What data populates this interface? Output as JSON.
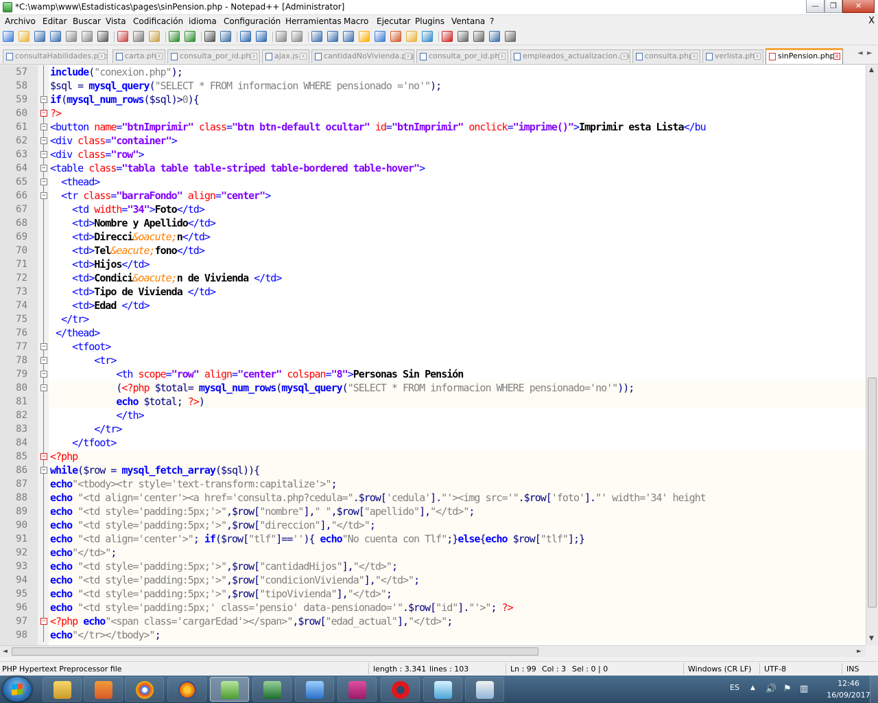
{
  "window": {
    "title": "*C:\\wamp\\www\\Estadisticas\\pages\\sinPension.php - Notepad++ [Administrator]",
    "min_label": "—",
    "max_label": "❐",
    "close_label": "✕"
  },
  "menu": [
    "Archivo",
    "Editar",
    "Buscar",
    "Vista",
    "Codificación",
    "idioma",
    "Configuración",
    "Herramientas",
    "Macro",
    "Ejecutar",
    "Plugins",
    "Ventana",
    "?"
  ],
  "menu_close": "X",
  "toolbar_icons": [
    "new-file-icon",
    "open-file-icon",
    "save-icon",
    "save-all-icon",
    "close-icon",
    "close-all-icon",
    "print-icon",
    "cut-icon",
    "copy-icon",
    "paste-icon",
    "undo-icon",
    "redo-icon",
    "find-icon",
    "replace-icon",
    "zoom-in-icon",
    "zoom-out-icon",
    "sync-v-icon",
    "sync-h-icon",
    "wrap-icon",
    "all-chars-icon",
    "indent-guide-icon",
    "user-lang-icon",
    "doc-map-icon",
    "function-list-icon",
    "folder-workspace-icon",
    "monitor-icon",
    "record-macro-icon",
    "stop-macro-icon",
    "play-macro-icon",
    "run-macro-multiple-icon",
    "save-macro-icon"
  ],
  "tabs": [
    {
      "label": "consultaHabilidades.php",
      "active": false
    },
    {
      "label": "carta.php",
      "active": false
    },
    {
      "label": "consulta_por_id.php",
      "active": false
    },
    {
      "label": "ajax.js",
      "active": false
    },
    {
      "label": "cantidadNoVivienda.php",
      "active": false
    },
    {
      "label": "consulta_por_id.php",
      "active": false
    },
    {
      "label": "empleados_actualizacion.php",
      "active": false
    },
    {
      "label": "consulta.php",
      "active": false
    },
    {
      "label": "verlista.php",
      "active": false
    },
    {
      "label": "sinPension.php",
      "active": true
    }
  ],
  "tab_close": "x",
  "tab_nav": [
    "◄",
    "►"
  ],
  "code_lines": [
    {
      "n": "57",
      "html": "<span class='k'>include</span><span class='o'>(</span><span class='s'>\"conexion.php\"</span><span class='o'>);</span>"
    },
    {
      "n": "58",
      "html": "<span class='v'>$sql</span> <span class='o'>=</span> <span class='k'>mysql_query</span><span class='o'>(</span><span class='s'>\"SELECT * FROM informacion WHERE pensionado ='no'\"</span><span class='o'>);</span>"
    },
    {
      "n": "59",
      "html": "<span class='k'>if</span><span class='o'>(</span><span class='k'>mysql_num_rows</span><span class='o'>(</span><span class='v'>$sql</span><span class='o'>)&gt;</span><span class='s'>0</span><span class='o'>){</span>"
    },
    {
      "n": "60",
      "html": "<span class='pt'>?&gt;</span>"
    },
    {
      "n": "61",
      "html": "<span class='t'>&lt;button</span> <span class='a'>name</span><span class='t'>=</span><span class='hv'>\"btnImprimir\"</span> <span class='a'>class</span><span class='t'>=</span><span class='hv'>\"btn btn-default ocultar\"</span> <span class='a'>id</span><span class='t'>=</span><span class='hv'>\"btnImprimir\"</span> <span class='a'>onclick</span><span class='t'>=</span><span class='hv'>\"imprime()\"</span><span class='t'>&gt;</span><span class='b'>Imprimir esta Lista</span><span class='t'>&lt;/bu</span>"
    },
    {
      "n": "62",
      "html": "<span class='t'>&lt;div</span> <span class='a'>class</span><span class='t'>=</span><span class='hv'>\"container\"</span><span class='t'>&gt;</span>"
    },
    {
      "n": "63",
      "html": "<span class='t'>&lt;div</span> <span class='a'>class</span><span class='t'>=</span><span class='hv'>\"row\"</span><span class='t'>&gt;</span>"
    },
    {
      "n": "64",
      "html": "<span class='t'>&lt;table</span> <span class='a'>class</span><span class='t'>=</span><span class='hv'>\"tabla table table-striped table-bordered table-hover\"</span><span class='t'>&gt;</span>"
    },
    {
      "n": "65",
      "html": "  <span class='t'>&lt;thead&gt;</span>"
    },
    {
      "n": "66",
      "html": "  <span class='t'>&lt;tr</span> <span class='a'>class</span><span class='t'>=</span><span class='hv'>\"barraFondo\"</span> <span class='a'>align</span><span class='t'>=</span><span class='hv'>\"center\"</span><span class='t'>&gt;</span>"
    },
    {
      "n": "67",
      "html": "    <span class='t'>&lt;td</span> <span class='a'>width</span><span class='t'>=</span><span class='hv'>\"34\"</span><span class='t'>&gt;</span><span class='b'>Foto</span><span class='t'>&lt;/td&gt;</span>"
    },
    {
      "n": "68",
      "html": "    <span class='t'>&lt;td&gt;</span><span class='b'>Nombre y Apellido</span><span class='t'>&lt;/td&gt;</span>"
    },
    {
      "n": "69",
      "html": "    <span class='t'>&lt;td&gt;</span><span class='b'>Direcci</span><span class='ent'>&amp;oacute;</span><span class='b'>n</span><span class='t'>&lt;/td&gt;</span>"
    },
    {
      "n": "70",
      "html": "    <span class='t'>&lt;td&gt;</span><span class='b'>Tel</span><span class='ent'>&amp;eacute;</span><span class='b'>fono</span><span class='t'>&lt;/td&gt;</span>"
    },
    {
      "n": "71",
      "html": "    <span class='t'>&lt;td&gt;</span><span class='b'>Hijos</span><span class='t'>&lt;/td&gt;</span>"
    },
    {
      "n": "72",
      "html": "    <span class='t'>&lt;td&gt;</span><span class='b'>Condici</span><span class='ent'>&amp;oacute;</span><span class='b'>n de Vivienda </span><span class='t'>&lt;/td&gt;</span>"
    },
    {
      "n": "73",
      "html": "    <span class='t'>&lt;td&gt;</span><span class='b'>Tipo de Vivienda </span><span class='t'>&lt;/td&gt;</span>"
    },
    {
      "n": "74",
      "html": "    <span class='t'>&lt;td&gt;</span><span class='b'>Edad </span><span class='t'>&lt;/td&gt;</span>"
    },
    {
      "n": "75",
      "html": "  <span class='t'>&lt;/tr&gt;</span>"
    },
    {
      "n": "76",
      "html": " <span class='t'>&lt;/thead&gt;</span>"
    },
    {
      "n": "77",
      "html": "    <span class='t'>&lt;tfoot&gt;</span>"
    },
    {
      "n": "78",
      "html": "        <span class='t'>&lt;tr&gt;</span>"
    },
    {
      "n": "79",
      "html": "            <span class='t'>&lt;th</span> <span class='a'>scope</span><span class='t'>=</span><span class='hv'>\"row\"</span> <span class='a'>align</span><span class='t'>=</span><span class='hv'>\"center\"</span> <span class='a'>colspan</span><span class='t'>=</span><span class='hv'>\"8\"</span><span class='t'>&gt;</span><span class='b'>Personas Sin Pensión</span>"
    },
    {
      "n": "80",
      "html": "            <span class='o'>(</span><span class='pt'>&lt;?php</span> <span class='v'>$total</span><span class='o'>=</span> <span class='k'>mysql_num_rows</span><span class='o'>(</span><span class='k'>mysql_query</span><span class='o'>(</span><span class='s'>\"SELECT * FROM informacion WHERE pensionado='no'\"</span><span class='o'>));</span>"
    },
    {
      "n": "81",
      "html": "            <span class='k'>echo</span> <span class='v'>$total</span><span class='o'>;</span> <span class='pt'>?&gt;</span><span class='o'>)</span>"
    },
    {
      "n": "82",
      "html": "            <span class='t'>&lt;/th&gt;</span>"
    },
    {
      "n": "83",
      "html": "        <span class='t'>&lt;/tr&gt;</span>"
    },
    {
      "n": "84",
      "html": "    <span class='t'>&lt;/tfoot&gt;</span>"
    },
    {
      "n": "85",
      "html": "<span class='pt'>&lt;?php</span>"
    },
    {
      "n": "86",
      "html": "<span class='k'>while</span><span class='o'>(</span><span class='v'>$row</span> <span class='o'>=</span> <span class='k'>mysql_fetch_array</span><span class='o'>(</span><span class='v'>$sql</span><span class='o'>)){</span>"
    },
    {
      "n": "87",
      "html": "<span class='k'>echo</span><span class='s'>\"&lt;tbody&gt;&lt;tr style='text-transform:capitalize'&gt;\"</span><span class='o'>;</span>"
    },
    {
      "n": "88",
      "html": "<span class='k'>echo</span> <span class='s'>\"&lt;td align='center'&gt;&lt;a href='consulta.php?cedula=\"</span><span class='o'>.</span><span class='v'>$row</span><span class='o'>[</span><span class='s'>'cedula'</span><span class='o'>].</span><span class='s'>\"'&gt;&lt;img src='\"</span><span class='o'>.</span><span class='v'>$row</span><span class='o'>[</span><span class='s'>'foto'</span><span class='o'>].</span><span class='s'>\"' width='34' height</span>"
    },
    {
      "n": "89",
      "html": "<span class='k'>echo</span> <span class='s'>\"&lt;td style='padding:5px;'&gt;\"</span><span class='o'>,</span><span class='v'>$row</span><span class='o'>[</span><span class='s'>\"nombre\"</span><span class='o'>],</span><span class='s'>\" \"</span><span class='o'>,</span><span class='v'>$row</span><span class='o'>[</span><span class='s'>\"apellido\"</span><span class='o'>],</span><span class='s'>\"&lt;/td&gt;\"</span><span class='o'>;</span>"
    },
    {
      "n": "90",
      "html": "<span class='k'>echo</span> <span class='s'>\"&lt;td style='padding:5px;'&gt;\"</span><span class='o'>,</span><span class='v'>$row</span><span class='o'>[</span><span class='s'>\"direccion\"</span><span class='o'>],</span><span class='s'>\"&lt;/td&gt;\"</span><span class='o'>;</span>"
    },
    {
      "n": "91",
      "html": "<span class='k'>echo</span> <span class='s'>\"&lt;td align='center'&gt;\"</span><span class='o'>;</span> <span class='k'>if</span><span class='o'>(</span><span class='v'>$row</span><span class='o'>[</span><span class='s'>\"tlf\"</span><span class='o'>]==</span><span class='s'>''</span><span class='o'>){</span> <span class='k'>echo</span><span class='s'>\"No cuenta con Tlf\"</span><span class='o'>;}</span><span class='k'>else</span><span class='o'>{</span><span class='k'>echo</span> <span class='v'>$row</span><span class='o'>[</span><span class='s'>\"tlf\"</span><span class='o'>];}</span>"
    },
    {
      "n": "92",
      "html": "<span class='k'>echo</span><span class='s'>\"&lt;/td&gt;\"</span><span class='o'>;</span>"
    },
    {
      "n": "93",
      "html": "<span class='k'>echo</span> <span class='s'>\"&lt;td style='padding:5px;'&gt;\"</span><span class='o'>,</span><span class='v'>$row</span><span class='o'>[</span><span class='s'>\"cantidadHijos\"</span><span class='o'>],</span><span class='s'>\"&lt;/td&gt;\"</span><span class='o'>;</span>"
    },
    {
      "n": "94",
      "html": "<span class='k'>echo</span> <span class='s'>\"&lt;td style='padding:5px;'&gt;\"</span><span class='o'>,</span><span class='v'>$row</span><span class='o'>[</span><span class='s'>\"condicionVivienda\"</span><span class='o'>],</span><span class='s'>\"&lt;/td&gt;\"</span><span class='o'>;</span>"
    },
    {
      "n": "95",
      "html": "<span class='k'>echo</span> <span class='s'>\"&lt;td style='padding:5px;'&gt;\"</span><span class='o'>,</span><span class='v'>$row</span><span class='o'>[</span><span class='s'>\"tipoVivienda\"</span><span class='o'>],</span><span class='s'>\"&lt;/td&gt;\"</span><span class='o'>;</span>"
    },
    {
      "n": "96",
      "html": "<span class='k'>echo</span> <span class='s'>\"&lt;td style='padding:5px;' class='pensio' data-pensionado='\"</span><span class='o'>.</span><span class='v'>$row</span><span class='o'>[</span><span class='s'>\"id\"</span><span class='o'>].</span><span class='s'>\"'&gt;\"</span><span class='o'>;</span> <span class='pt'>?&gt;</span>"
    },
    {
      "n": "97",
      "html": "<span class='pt'>&lt;?php</span> <span class='k'>echo</span><span class='s'>\"&lt;span class='cargarEdad'&gt;&lt;/span&gt;\"</span><span class='o'>,</span><span class='v'>$row</span><span class='o'>[</span><span class='s'>\"edad_actual\"</span><span class='o'>],</span><span class='s'>\"&lt;/td&gt;\"</span><span class='o'>;</span>"
    },
    {
      "n": "98",
      "html": "<span class='k'>echo</span><span class='s'>\"&lt;/tr&gt;&lt;/tbody&gt;\"</span><span class='o'>;</span>"
    }
  ],
  "status": {
    "filetype": "PHP Hypertext Preprocessor file",
    "length": "length : 3.341",
    "lines": "lines : 103",
    "ln": "Ln : 99",
    "col": "Col : 3",
    "sel": "Sel : 0 | 0",
    "eol": "Windows (CR LF)",
    "encoding": "UTF-8",
    "mode": "INS"
  },
  "taskbar": {
    "apps": [
      "file-explorer",
      "media-player",
      "chrome",
      "firefox",
      "notepad-plus-plus",
      "excel-notepad",
      "flash",
      "winamp-like",
      "opera",
      "glass-window",
      "paint"
    ],
    "lang": "ES",
    "time": "12:46",
    "date": "16/09/2017"
  },
  "colors": {
    "keyword": "#0000ff",
    "string": "#808080",
    "variable": "#000080",
    "html_attr": "#ff0000",
    "html_value": "#8000ff",
    "active_tab_accent": "#f7a43a"
  }
}
